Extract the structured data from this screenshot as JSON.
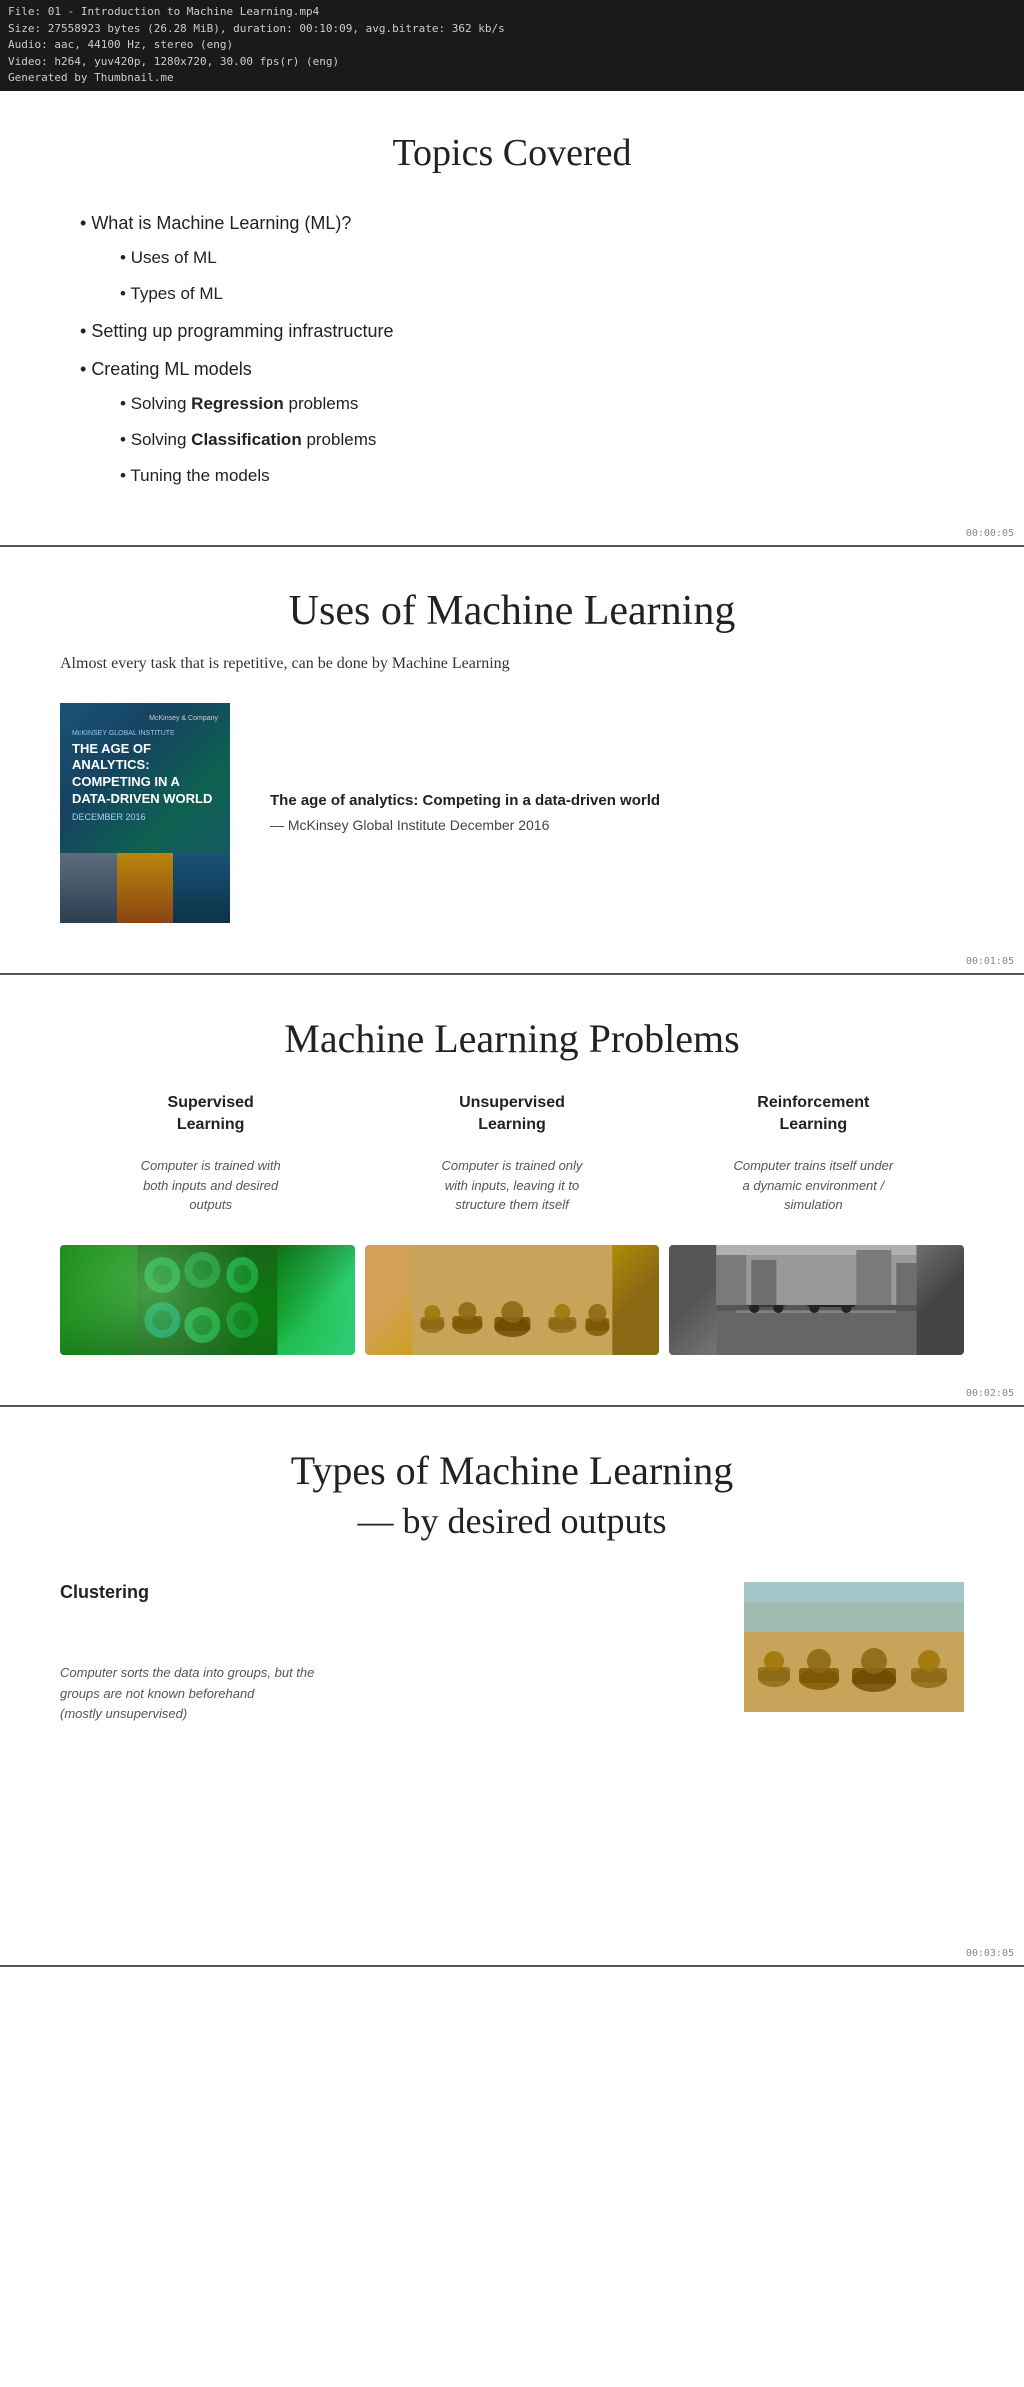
{
  "fileInfo": {
    "line1": "File: 01 - Introduction to Machine Learning.mp4",
    "line2": "Size: 27558923 bytes (26.28 MiB), duration: 00:10:09, avg.bitrate: 362 kb/s",
    "line3": "Audio: aac, 44100 Hz, stereo (eng)",
    "line4": "Video: h264, yuv420p, 1280x720, 30.00 fps(r) (eng)",
    "line5": "Generated by Thumbnail.me"
  },
  "slide1": {
    "title": "Topics Covered",
    "items": [
      {
        "text": "What is Machine Learning (ML)?",
        "children": [
          {
            "text": "Uses of ML"
          },
          {
            "text": "Types of ML"
          }
        ]
      },
      {
        "text": "Setting up programming infrastructure"
      },
      {
        "text": "Creating ML models",
        "children": [
          {
            "text": "Solving ",
            "bold": "Regression",
            "after": " problems"
          },
          {
            "text": "Solving ",
            "bold": "Classification",
            "after": " problems"
          },
          {
            "text": "Tuning the models"
          }
        ]
      }
    ],
    "timestamp": "00:00:05"
  },
  "slide2": {
    "title": "Uses of Machine Learning",
    "subtitle": "Almost every task that is repetitive, can be done by Machine Learning",
    "book": {
      "logo": "McKinsey Company",
      "institute": "McKINSEY GLOBAL INSTITUTE",
      "title": "THE AGE OF ANALYTICS: COMPETING IN A DATA-DRIVEN WORLD",
      "date": "DECEMBER 2016",
      "caption_title": "The age of analytics: Competing in a data-driven world",
      "caption_source": "— McKinsey Global Institute December 2016"
    },
    "timestamp": "00:01:05"
  },
  "slide3": {
    "title": "Machine Learning Problems",
    "columns": [
      {
        "title": "Supervised\nLearning",
        "desc": "Computer is trained with\nboth inputs and desired\noutputs"
      },
      {
        "title": "Unsupervised\nLearning",
        "desc": "Computer is trained only\nwith inputs, leaving it to\nstructure them itself"
      },
      {
        "title": "Reinforcement\nLearning",
        "desc": "Computer trains itself under\na dynamic environment /\nsimulation"
      }
    ],
    "timestamp": "00:02:05"
  },
  "slide4": {
    "title": "Types of Machine Learning",
    "subtitle": "— by desired outputs",
    "clustering": {
      "title": "Clustering",
      "desc": "Computer sorts the data into groups, but the\ngroups are not known beforehand\n(mostly unsupervised)"
    },
    "timestamp": "00:03:05"
  }
}
